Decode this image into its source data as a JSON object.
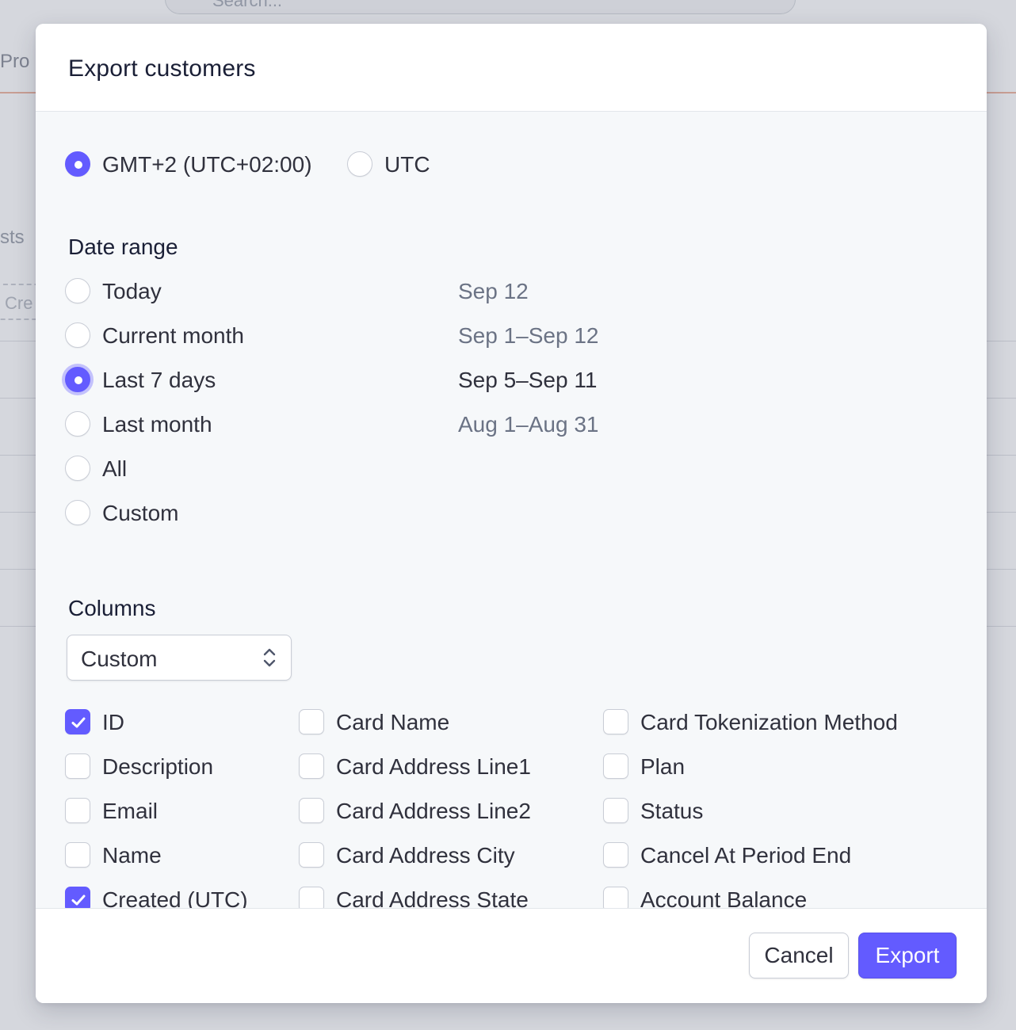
{
  "background": {
    "search_placeholder": "Search...",
    "tab_partial": "Pro",
    "left_text_1": "sts",
    "left_text_2": "Cre"
  },
  "modal": {
    "title": "Export customers",
    "timezone": {
      "options": [
        {
          "label": "GMT+2 (UTC+02:00)",
          "checked": true
        },
        {
          "label": "UTC",
          "checked": false
        }
      ]
    },
    "date_range": {
      "label": "Date range",
      "options": [
        {
          "label": "Today",
          "range": "Sep 12",
          "checked": false
        },
        {
          "label": "Current month",
          "range": "Sep 1–Sep 12",
          "checked": false
        },
        {
          "label": "Last 7 days",
          "range": "Sep 5–Sep 11",
          "checked": true
        },
        {
          "label": "Last month",
          "range": "Aug 1–Aug 31",
          "checked": false
        },
        {
          "label": "All",
          "range": "",
          "checked": false
        },
        {
          "label": "Custom",
          "range": "",
          "checked": false
        }
      ]
    },
    "columns": {
      "label": "Columns",
      "preset": "Custom",
      "col1": [
        {
          "label": "ID",
          "checked": true
        },
        {
          "label": "Description",
          "checked": false
        },
        {
          "label": "Email",
          "checked": false
        },
        {
          "label": "Name",
          "checked": false
        },
        {
          "label": "Created (UTC)",
          "checked": true
        }
      ],
      "col2": [
        {
          "label": "Card Name",
          "checked": false
        },
        {
          "label": "Card Address Line1",
          "checked": false
        },
        {
          "label": "Card Address Line2",
          "checked": false
        },
        {
          "label": "Card Address City",
          "checked": false
        },
        {
          "label": "Card Address State",
          "checked": false
        }
      ],
      "col3": [
        {
          "label": "Card Tokenization Method",
          "checked": false
        },
        {
          "label": "Plan",
          "checked": false
        },
        {
          "label": "Status",
          "checked": false
        },
        {
          "label": "Cancel At Period End",
          "checked": false
        },
        {
          "label": "Account Balance",
          "checked": false
        }
      ]
    },
    "footer": {
      "cancel_label": "Cancel",
      "export_label": "Export"
    }
  },
  "colors": {
    "accent": "#635bff",
    "text": "#30313d",
    "muted": "#6b7385"
  }
}
